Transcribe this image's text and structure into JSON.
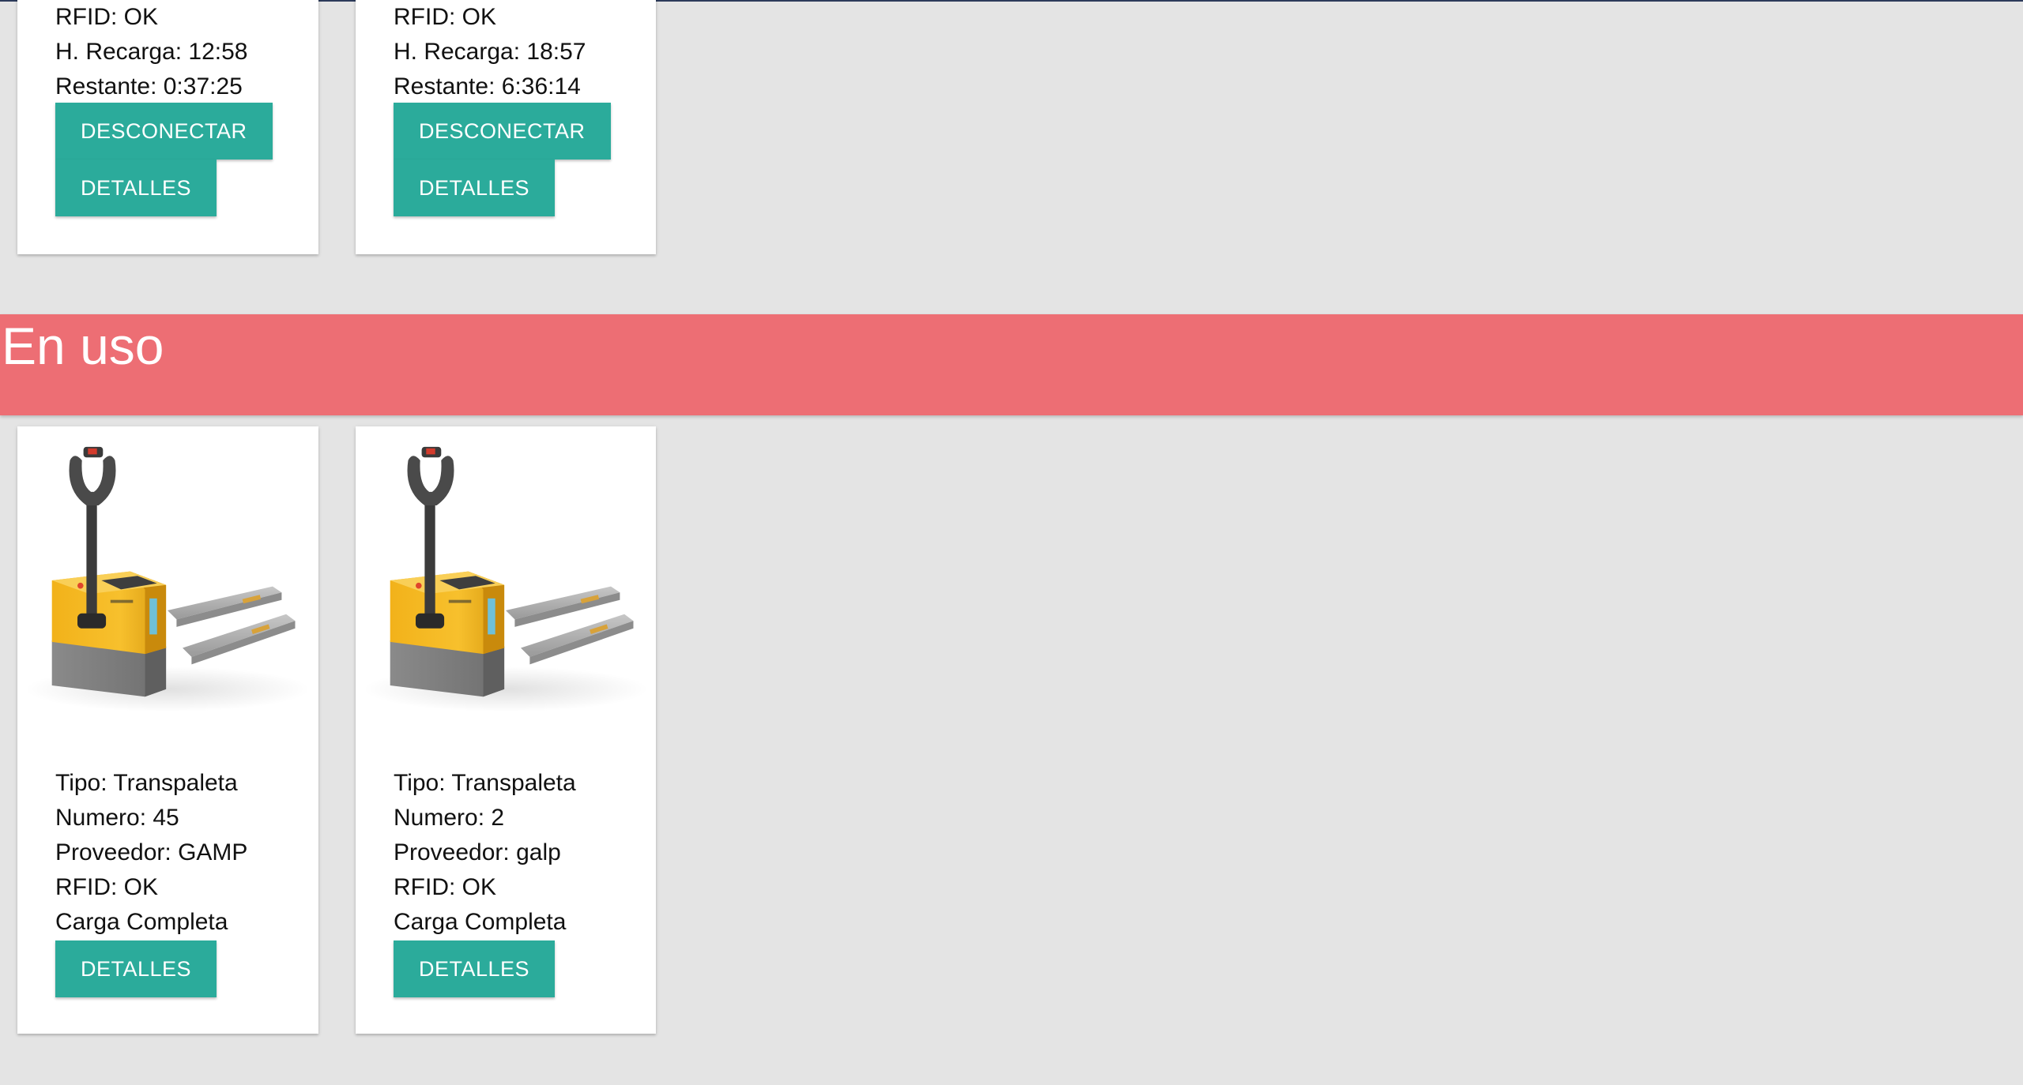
{
  "top_cards": [
    {
      "rfid": "RFID: OK",
      "recharge_time": "H. Recarga: 12:58",
      "remaining": "Restante: 0:37:25",
      "disconnect_label": "DESCONECTAR",
      "details_label": "DETALLES"
    },
    {
      "rfid": "RFID: OK",
      "recharge_time": "H. Recarga: 18:57",
      "remaining": "Restante: 6:36:14",
      "disconnect_label": "DESCONECTAR",
      "details_label": "DETALLES"
    }
  ],
  "in_use_section": {
    "title": "En uso",
    "banner_color": "#ed6e74"
  },
  "in_use_cards": [
    {
      "image_icon": "electric-pallet-truck",
      "tipo": "Tipo: Transpaleta",
      "numero": "Numero: 45",
      "proveedor": "Proveedor: GAMP",
      "rfid": "RFID: OK",
      "carga": "Carga Completa",
      "details_label": "DETALLES"
    },
    {
      "image_icon": "electric-pallet-truck",
      "tipo": "Tipo: Transpaleta",
      "numero": "Numero: 2",
      "proveedor": "Proveedor: galp",
      "rfid": "RFID: OK",
      "carga": "Carga Completa",
      "details_label": "DETALLES"
    }
  ],
  "colors": {
    "background": "#e4e4e4",
    "button": "#2bab9b",
    "card": "#ffffff"
  }
}
